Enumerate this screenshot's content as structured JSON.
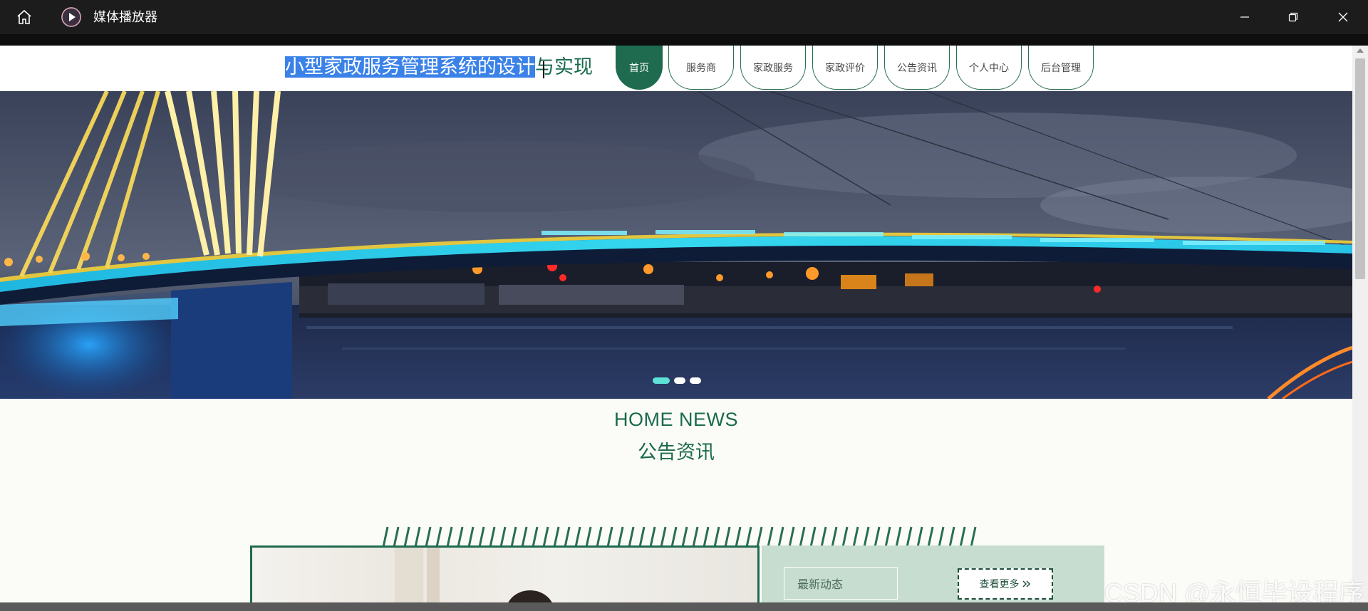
{
  "window": {
    "title": "媒体播放器",
    "home_icon": "home-icon",
    "app_icon": "media-player-icon",
    "controls": [
      "minimize-icon",
      "maximize-icon",
      "close-icon"
    ]
  },
  "site": {
    "title_selected": "小型家政服务管理系统的设计",
    "title_rest": "与实现",
    "nav": [
      {
        "label": "首页",
        "active": true
      },
      {
        "label": "服务商",
        "active": false
      },
      {
        "label": "家政服务",
        "active": false
      },
      {
        "label": "家政评价",
        "active": false
      },
      {
        "label": "公告资讯",
        "active": false
      },
      {
        "label": "个人中心",
        "active": false
      },
      {
        "label": "后台管理",
        "active": false
      }
    ],
    "banner": {
      "slides_total": 3,
      "slide_active_index": 0
    },
    "news": {
      "title_en": "HOME NEWS",
      "title_cn": "公告资讯",
      "latest_label": "最新动态",
      "more_label": "查看更多",
      "more_icon": "double-chevron-right-icon"
    }
  },
  "watermark": "CSDN @永恒毕设程序",
  "colors": {
    "brand_green": "#1f6b4f",
    "accent_teal": "#5ee2d8",
    "panel_green": "#c6ddd0",
    "selection_blue": "#3b82e8"
  }
}
